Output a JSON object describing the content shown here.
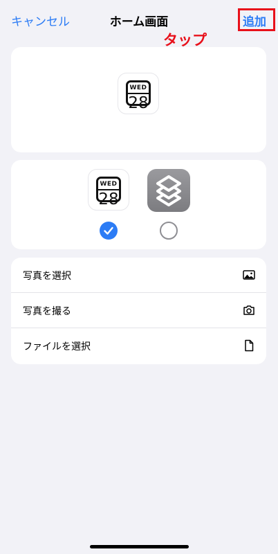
{
  "nav": {
    "cancel_label": "キャンセル",
    "title": "ホーム画面",
    "add_label": "追加",
    "annotation": "タップ"
  },
  "preview": {
    "icon": "calendar-icon",
    "day": "WED",
    "date": "28"
  },
  "choice": {
    "calendar_day": "WED",
    "calendar_date": "28",
    "calendar_selected": true,
    "shortcuts_icon": "shortcuts-icon",
    "shortcuts_selected": false
  },
  "list": {
    "items": [
      {
        "label": "写真を選択",
        "icon": "photo-icon"
      },
      {
        "label": "写真を撮る",
        "icon": "camera-icon"
      },
      {
        "label": "ファイルを選択",
        "icon": "document-icon"
      }
    ]
  },
  "colors": {
    "accent": "#2c7cf5",
    "highlight": "#e8101a",
    "background": "#f2f2f7"
  }
}
